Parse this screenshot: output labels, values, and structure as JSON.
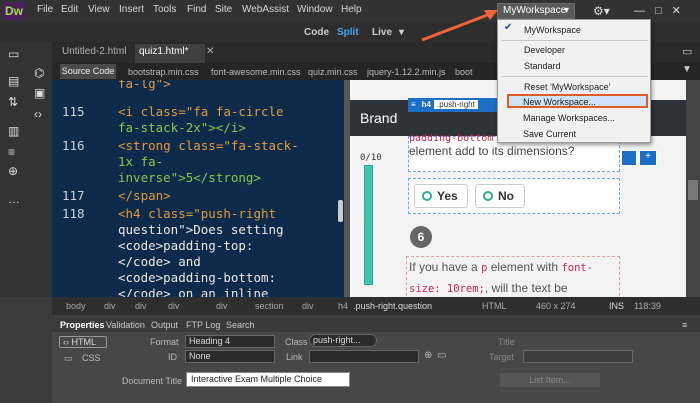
{
  "app": {
    "logo": "Dw",
    "menus": [
      "File",
      "Edit",
      "View",
      "Insert",
      "Tools",
      "Find",
      "Site",
      "WebAssist",
      "Window",
      "Help"
    ],
    "workspace": "MyWorkspace",
    "caret": "▾",
    "gear": "⚙▾",
    "win_controls": "—□✕"
  },
  "view_modes": {
    "code": "Code",
    "split": "Split",
    "live": "Live",
    "live_caret": "▾"
  },
  "tabs": [
    "Untitled-2.html",
    "quiz1.html*"
  ],
  "source_files": {
    "source_code": "Source Code",
    "files": [
      "bootstrap.min.css",
      "font-awesome.min.css",
      "quiz.min.css",
      "jquery-1.12.2.min.js",
      "boot"
    ]
  },
  "code_lines": [
    {
      "n": "115",
      "t1": "fa-lg\">",
      "t2": "<i class=\"fa fa-circle",
      "t3": "fa-stack-2x\"></i>"
    },
    {
      "n": "116",
      "t1": "<strong class=\"fa-stack-",
      "t2": "1x fa-",
      "t3": "inverse\">5</strong>"
    },
    {
      "n": "117",
      "t1": "</span>"
    },
    {
      "n": "118",
      "t1": "<h4 class=\"push-right",
      "t2": "question\">Does setting",
      "t3": "<code>padding-top:",
      "t4": "</code> and",
      "t5": "<code>padding-bottom:",
      "t6": "</code> on an inline"
    }
  ],
  "live": {
    "brand": "Brand",
    "hud_tag": "h4",
    "hud_class": ".push-right",
    "q1_code": "padding-bottom",
    "q1_text": "element add to its dimensions?",
    "score": "0/10",
    "answers": [
      "Yes",
      "No"
    ],
    "q_number": "6",
    "q6_a": "If you have a",
    "q6_b": "p",
    "q6_c": "element with",
    "q6_d": "font-",
    "q6_e": "size: 10rem;",
    "q6_f": ", will the text be"
  },
  "dropdown": {
    "items": [
      "MyWorkspace",
      "Developer",
      "Standard",
      "Reset 'MyWorkspace'",
      "New Workspace...",
      "Manage Workspaces...",
      "Save Current"
    ],
    "checked": "✔"
  },
  "status": {
    "crumbs": [
      "body",
      "div",
      "div",
      "div",
      "div",
      "section",
      "div",
      "h4",
      ".push-right.question"
    ],
    "mode": "HTML",
    "size": "460 x 274",
    "ins": "INS",
    "pos": "118:39"
  },
  "properties": {
    "tabs": [
      "Properties",
      "Validation",
      "Output",
      "FTP Log",
      "Search"
    ],
    "html": "HTML",
    "css": "CSS",
    "format_label": "Format",
    "format": "Heading 4",
    "id_label": "ID",
    "id": "None",
    "class_label": "Class",
    "class": "push-right...",
    "link_label": "Link",
    "title_label": "Title",
    "target_label": "Target",
    "doc_title_label": "Document Title",
    "doc_title": "Interactive Exam Multiple Choice",
    "list_item": "List Item..."
  }
}
